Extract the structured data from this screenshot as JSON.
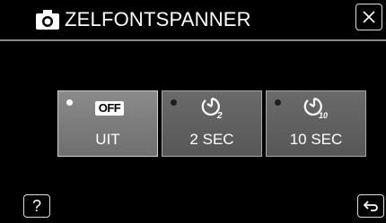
{
  "header": {
    "title": "ZELFONTSPANNER",
    "mode_icon": "camera-icon",
    "close_icon": "close-icon"
  },
  "options": [
    {
      "icon": "off",
      "badge": "OFF",
      "label": "UIT",
      "selected": true
    },
    {
      "icon": "self-timer-2-icon",
      "label": "2 SEC",
      "selected": false
    },
    {
      "icon": "self-timer-10-icon",
      "label": "10 SEC",
      "selected": false
    }
  ],
  "footer": {
    "help_label": "?",
    "back_icon": "return-icon"
  },
  "colors": {
    "background": "#000000",
    "button_fill": "#5f5f5f",
    "selected_indicator": "#ffffff"
  }
}
